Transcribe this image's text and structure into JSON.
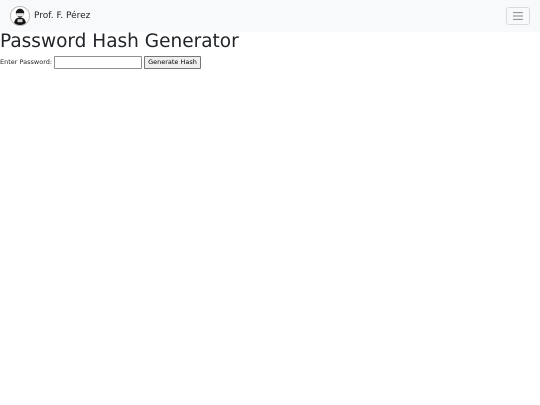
{
  "navbar": {
    "brand_name": "Prof. F. Pérez",
    "avatar_icon": "person-silhouette-icon",
    "menu_icon": "hamburger-menu-icon"
  },
  "main": {
    "title": "Password Hash Generator",
    "password_label": "Enter Password:",
    "password_value": "",
    "password_placeholder": "",
    "submit_label": "Generate Hash"
  }
}
